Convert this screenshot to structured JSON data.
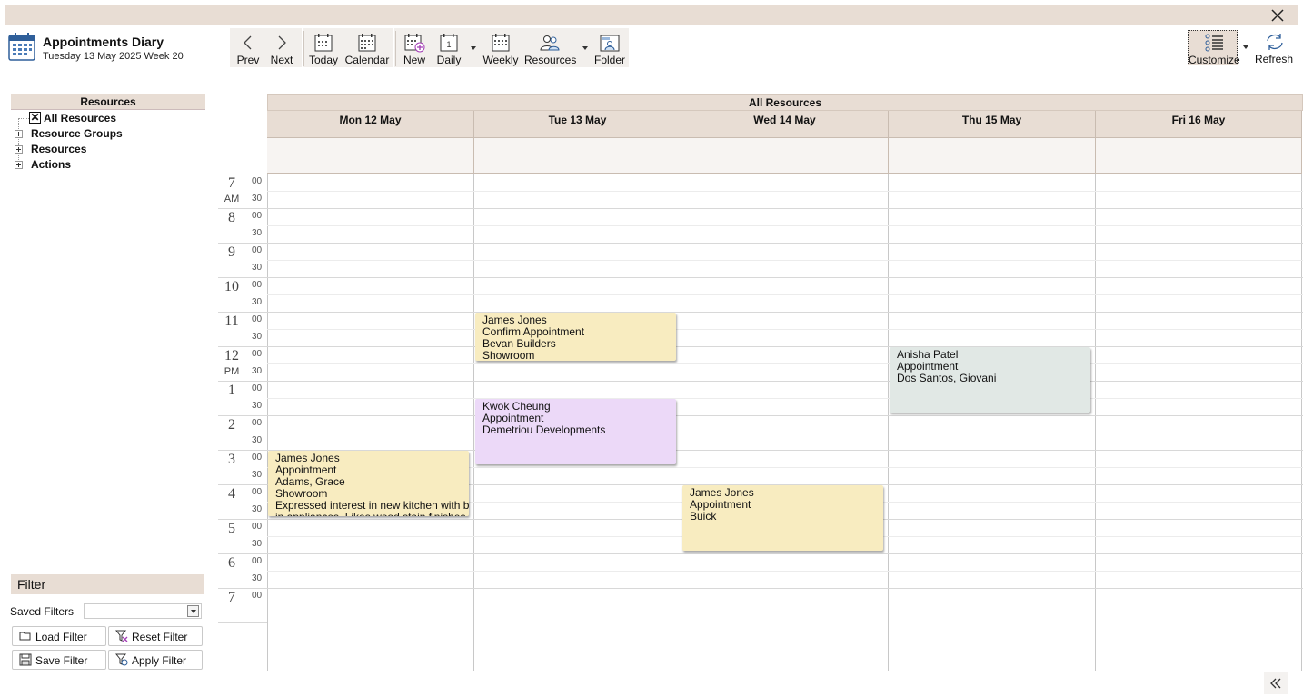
{
  "app": {
    "title": "Appointments Diary",
    "subtitle": "Tuesday 13 May 2025 Week 20"
  },
  "toolbar": {
    "prev": "Prev",
    "next": "Next",
    "today": "Today",
    "calendar": "Calendar",
    "new": "New",
    "daily": "Daily",
    "weekly": "Weekly",
    "resources": "Resources",
    "folder": "Folder",
    "customize": "Customize",
    "refresh": "Refresh",
    "daily_icon_num": "1"
  },
  "sidebar": {
    "header": "Resources",
    "items": [
      {
        "label": "All Resources",
        "checked": true
      },
      {
        "label": "Resource Groups"
      },
      {
        "label": "Resources"
      },
      {
        "label": "Actions"
      }
    ]
  },
  "filter": {
    "header": "Filter",
    "saved_label": "Saved Filters",
    "saved_value": "",
    "load": "Load Filter",
    "reset": "Reset Filter",
    "save": "Save Filter",
    "apply": "Apply Filter"
  },
  "calendar": {
    "header": "All Resources",
    "days": [
      "Mon 12 May",
      "Tue 13 May",
      "Wed 14 May",
      "Thu 15 May",
      "Fri 16 May"
    ],
    "hours": [
      "7",
      "8",
      "9",
      "10",
      "11",
      "12",
      "1",
      "2",
      "3",
      "4",
      "5",
      "6",
      "7"
    ],
    "am": "AM",
    "pm": "PM",
    "min00": "00",
    "min30": "30",
    "appointments": [
      {
        "day": "Tue 13 May",
        "start": "11:00",
        "end": "12:30",
        "color": "#f8ecc0",
        "lines": [
          "James Jones",
          "Confirm Appointment",
          "Bevan Builders",
          "Showroom"
        ]
      },
      {
        "day": "Thu 15 May",
        "start": "12:00",
        "end": "14:00",
        "color": "#e1e8e5",
        "lines": [
          "Anisha Patel",
          "Appointment",
          "Dos Santos, Giovani"
        ]
      },
      {
        "day": "Tue 13 May",
        "start": "13:30",
        "end": "15:30",
        "color": "#ecd9f8",
        "lines": [
          "Kwok Cheung",
          "Appointment",
          "Demetriou Developments"
        ]
      },
      {
        "day": "Mon 12 May",
        "start": "15:00",
        "end": "17:00",
        "color": "#f8ecc0",
        "lines": [
          "James Jones",
          "Appointment",
          "Adams, Grace",
          "Showroom",
          "Expressed interest in new kitchen with built",
          "in appliances. Likes wood stain finishes"
        ]
      },
      {
        "day": "Wed 14 May",
        "start": "16:00",
        "end": "18:00",
        "color": "#f8ecc0",
        "lines": [
          "James Jones",
          "Appointment",
          "Buick"
        ]
      }
    ]
  }
}
